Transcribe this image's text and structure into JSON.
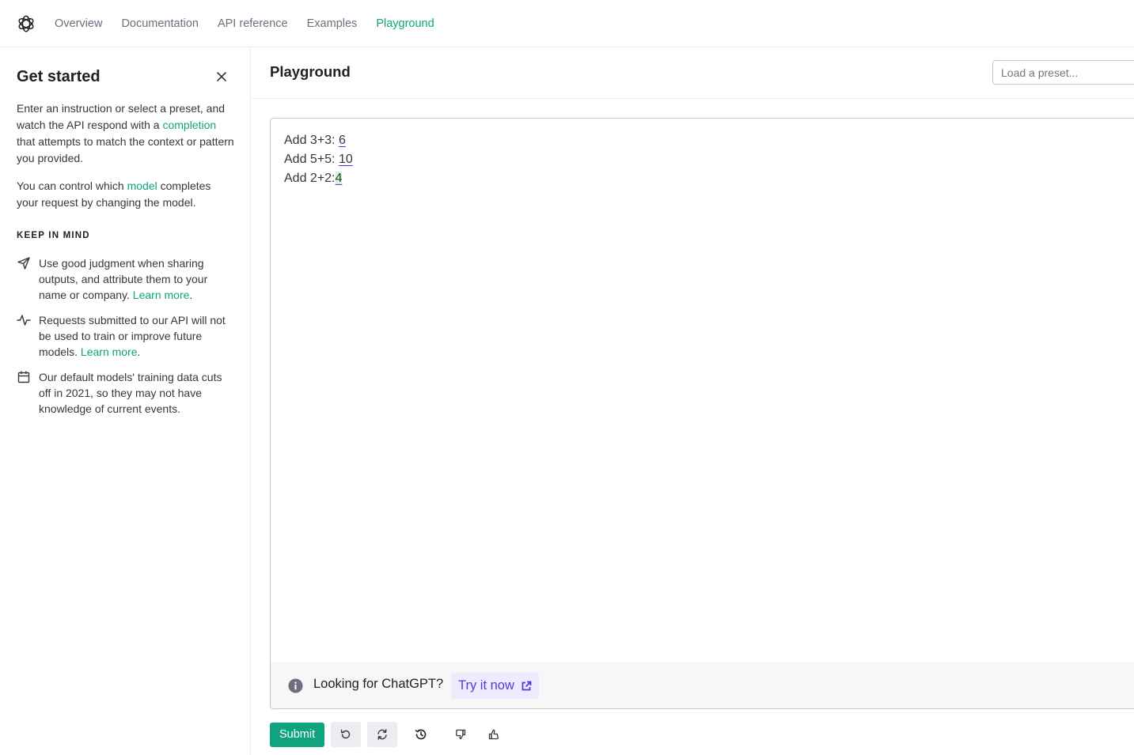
{
  "nav": {
    "logo": "openai-logo",
    "links": [
      {
        "label": "Overview",
        "active": false
      },
      {
        "label": "Documentation",
        "active": false
      },
      {
        "label": "API reference",
        "active": false
      },
      {
        "label": "Examples",
        "active": false
      },
      {
        "label": "Playground",
        "active": true
      }
    ]
  },
  "sidebar": {
    "title": "Get started",
    "close_icon": "close-icon",
    "intro": {
      "part1": "Enter an instruction or select a preset, and watch the API respond with a ",
      "link": "completion",
      "part2": " that attempts to match the context or pattern you provided."
    },
    "model_para": {
      "part1": "You can control which ",
      "link": "model",
      "part2": " completes your request by changing the model."
    },
    "keep_in_mind": {
      "heading": "KEEP IN MIND",
      "items": [
        {
          "icon": "send-icon",
          "text": "Use good judgment when sharing outputs, and attribute them to your name or company. ",
          "link": "Learn more",
          "suffix": "."
        },
        {
          "icon": "activity-icon",
          "text": "Requests submitted to our API will not be used to train or improve future models. ",
          "link": "Learn more",
          "suffix": "."
        },
        {
          "icon": "calendar-icon",
          "text": "Our default models' training data cuts off in 2021, so they may not have knowledge of current events.",
          "link": "",
          "suffix": ""
        }
      ]
    }
  },
  "main": {
    "title": "Playground",
    "preset_placeholder": "Load a preset...",
    "editor": {
      "lines": [
        {
          "prompt": "Add 3+3: ",
          "completion": "6"
        },
        {
          "prompt": "Add 5+5: ",
          "completion": "10"
        },
        {
          "prompt": "Add 2+2:",
          "completion": "4"
        }
      ]
    },
    "banner": {
      "text": "Looking for ChatGPT?",
      "button": "Try it now"
    },
    "toolbar": {
      "submit": "Submit",
      "undo": "undo-icon",
      "regenerate": "regenerate-icon",
      "history": "history-icon",
      "thumbs_down": "thumbs-down-icon",
      "thumbs_up": "thumbs-up-icon"
    }
  },
  "colors": {
    "accent": "#10a37f",
    "link_purple": "#5436da",
    "highlight": "#d2f4d3"
  }
}
